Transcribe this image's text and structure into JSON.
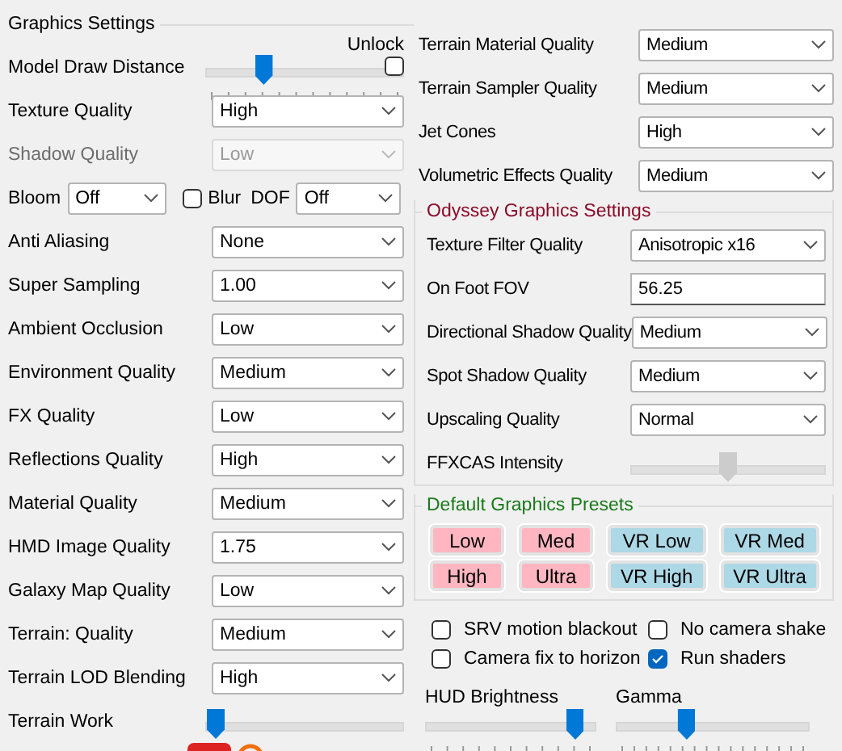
{
  "graphics_settings": {
    "title": "Graphics Settings",
    "rows": [
      {
        "kind": "slider",
        "label": "Model Draw Distance",
        "level": 0.27,
        "unlock": {
          "label": "Unlock",
          "checked": false
        }
      },
      {
        "kind": "select",
        "label": "Texture Quality",
        "value": "High",
        "disabled": false
      },
      {
        "kind": "select",
        "label": "Shadow Quality",
        "value": "Low",
        "disabled": true
      },
      {
        "kind": "effects",
        "bloom_label": "Bloom",
        "bloom_value": "Off",
        "blur": {
          "label": "Blur",
          "checked": false
        },
        "dof_label": "DOF",
        "dof_value": "Off"
      },
      {
        "kind": "select",
        "label": "Anti Aliasing",
        "value": "None",
        "disabled": false
      },
      {
        "kind": "select",
        "label": "Super Sampling",
        "value": "1.00",
        "disabled": false
      },
      {
        "kind": "select",
        "label": "Ambient Occlusion",
        "value": "Low",
        "disabled": false
      },
      {
        "kind": "select",
        "label": "Environment Quality",
        "value": "Medium",
        "disabled": false
      },
      {
        "kind": "select",
        "label": "FX Quality",
        "value": "Low",
        "disabled": false
      },
      {
        "kind": "select",
        "label": "Reflections Quality",
        "value": "High",
        "disabled": false
      },
      {
        "kind": "select",
        "label": "Material Quality",
        "value": "Medium",
        "disabled": false
      },
      {
        "kind": "select",
        "label": "HMD Image Quality",
        "value": "1.75",
        "disabled": false
      },
      {
        "kind": "select",
        "label": "Galaxy Map Quality",
        "value": "Low",
        "disabled": false
      },
      {
        "kind": "select",
        "label": "Terrain: Quality",
        "value": "Medium",
        "disabled": false
      },
      {
        "kind": "select",
        "label": "Terrain LOD Blending",
        "value": "High",
        "disabled": false
      },
      {
        "kind": "slider",
        "label": "Terrain Work",
        "level": 0
      }
    ]
  },
  "right_settings": [
    {
      "kind": "select",
      "label": "Terrain Material Quality",
      "value": "Medium"
    },
    {
      "kind": "select",
      "label": "Terrain Sampler Quality",
      "value": "Medium"
    },
    {
      "kind": "select",
      "label": "Jet Cones",
      "value": "High"
    },
    {
      "kind": "select",
      "label": "Volumetric Effects Quality",
      "value": "Medium"
    }
  ],
  "odyssey_settings": {
    "title": "Odyssey Graphics Settings",
    "rows": [
      {
        "kind": "select",
        "label": "Texture Filter Quality",
        "value": "Anisotropic x16"
      },
      {
        "kind": "input",
        "label": "On Foot FOV",
        "value": "56.25"
      },
      {
        "kind": "select",
        "label": "Directional Shadow Quality",
        "value": "Medium"
      },
      {
        "kind": "select",
        "label": "Spot Shadow Quality",
        "value": "Medium"
      },
      {
        "kind": "select",
        "label": "Upscaling Quality",
        "value": "Normal"
      },
      {
        "kind": "slider",
        "label": "FFXCAS Intensity",
        "level": 0.5,
        "disabled": true
      }
    ]
  },
  "presets": {
    "title": "Default Graphics Presets",
    "buttons": [
      {
        "label": "Low",
        "color": "#ffb6c1"
      },
      {
        "label": "Med",
        "color": "#ffb6c1"
      },
      {
        "label": "VR Low",
        "color": "#add8e6"
      },
      {
        "label": "VR Med",
        "color": "#add8e6"
      },
      {
        "label": "High",
        "color": "#ffb6c1"
      },
      {
        "label": "Ultra",
        "color": "#ffb6c1"
      },
      {
        "label": "VR High",
        "color": "#add8e6"
      },
      {
        "label": "VR Ultra",
        "color": "#add8e6"
      }
    ]
  },
  "options": [
    {
      "label": "SRV motion blackout",
      "checked": false
    },
    {
      "label": "No camera shake",
      "checked": false
    },
    {
      "label": "Camera fix to horizon",
      "checked": false
    },
    {
      "label": "Run shaders",
      "checked": true
    }
  ],
  "sliders": [
    {
      "label": "HUD Brightness",
      "level": 0.93
    },
    {
      "label": "Gamma",
      "level": 0.35
    }
  ]
}
